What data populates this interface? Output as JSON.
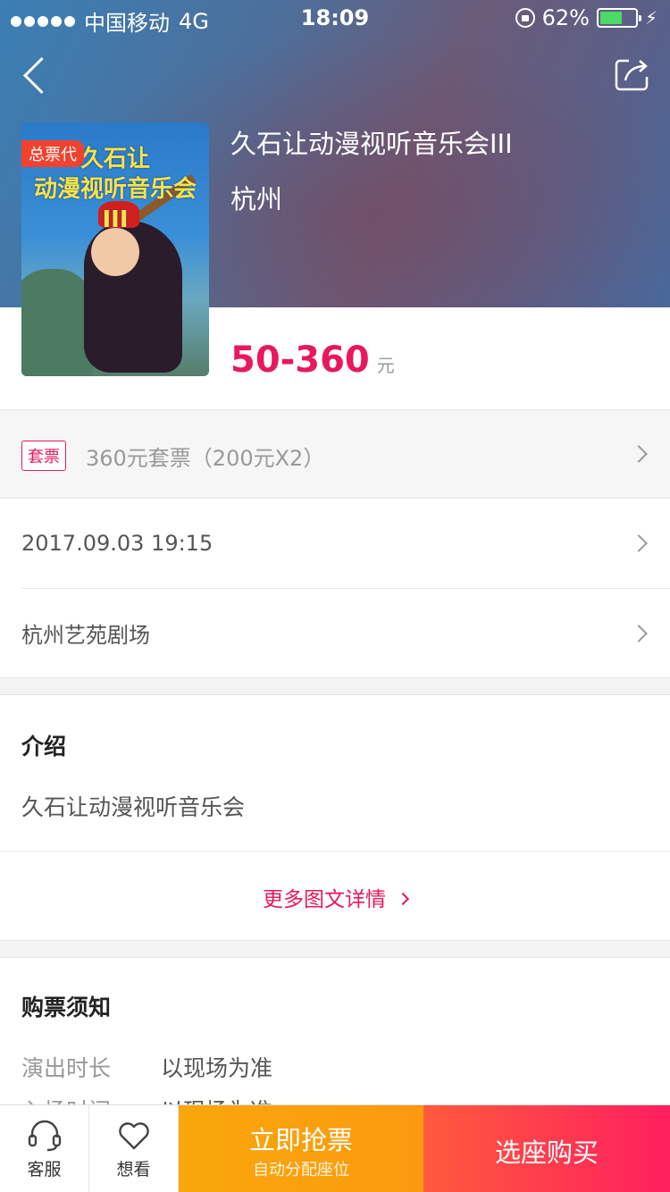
{
  "status_bar": {
    "carrier": "中国移动",
    "network": "4G",
    "time": "18:09",
    "battery": "62%",
    "battery_level": 0.62
  },
  "event": {
    "poster_title_line1": "久石让",
    "poster_title_line2": "动漫视听音乐会III",
    "poster_badge": "总票代",
    "title": "久石让动漫视听音乐会III",
    "city": "杭州",
    "price": "50-360",
    "price_unit": "元"
  },
  "package": {
    "tag": "套票",
    "text": "360元套票（200元X2）"
  },
  "date_time": "2017.09.03 19:15",
  "venue": "杭州艺苑剧场",
  "intro": {
    "title": "介绍",
    "text": "久石让动漫视听音乐会",
    "more": "更多图文详情"
  },
  "notice": {
    "title": "购票须知",
    "rows": [
      {
        "key": "演出时长",
        "value": "以现场为准"
      },
      {
        "key": "入场时间",
        "value": "以现场为准"
      }
    ]
  },
  "bottom_bar": {
    "service": "客服",
    "want": "想看",
    "grab_main": "立即抢票",
    "grab_sub": "自动分配座位",
    "seat": "选座购买"
  },
  "colors": {
    "accent": "#e8185a",
    "grab": "#f9a70b",
    "seat": "#ff2b5a"
  }
}
